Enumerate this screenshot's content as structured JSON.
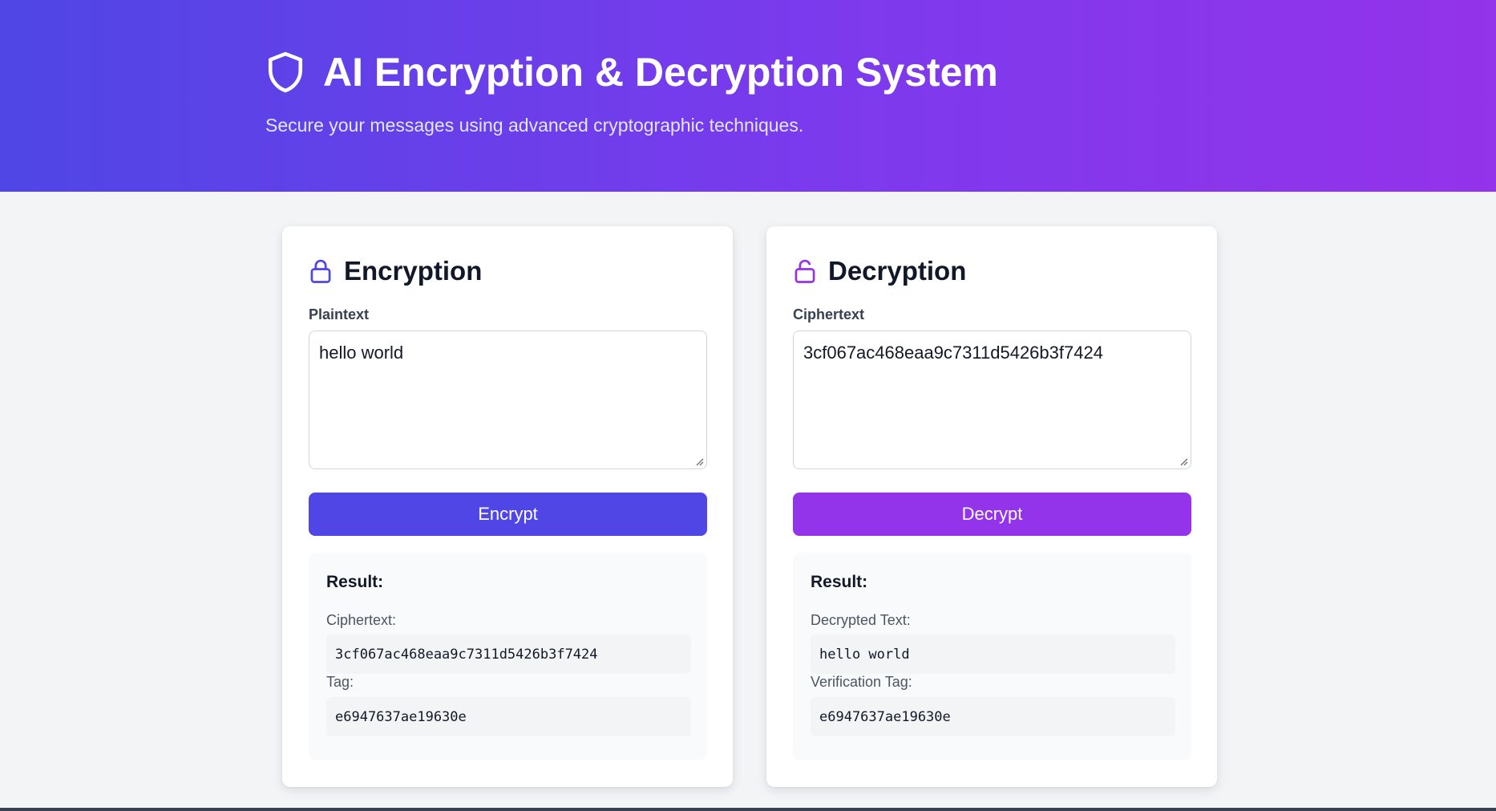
{
  "header": {
    "title": "AI Encryption & Decryption System",
    "subtitle": "Secure your messages using advanced cryptographic techniques.",
    "icon": "shield-icon",
    "gradient_start": "#4f46e5",
    "gradient_end": "#9333ea"
  },
  "encryption": {
    "title": "Encryption",
    "icon": "lock-icon",
    "input_label": "Plaintext",
    "input_value": "hello world",
    "button_label": "Encrypt",
    "button_color": "#4f46e5",
    "result_heading": "Result:",
    "result_fields": [
      {
        "label": "Ciphertext:",
        "value": "3cf067ac468eaa9c7311d5426b3f7424"
      },
      {
        "label": "Tag:",
        "value": "e6947637ae19630e"
      }
    ]
  },
  "decryption": {
    "title": "Decryption",
    "icon": "unlock-icon",
    "input_label": "Ciphertext",
    "input_value": "3cf067ac468eaa9c7311d5426b3f7424",
    "button_label": "Decrypt",
    "button_color": "#9333ea",
    "result_heading": "Result:",
    "result_fields": [
      {
        "label": "Decrypted Text:",
        "value": "hello world"
      },
      {
        "label": "Verification Tag:",
        "value": "e6947637ae19630e"
      }
    ]
  }
}
